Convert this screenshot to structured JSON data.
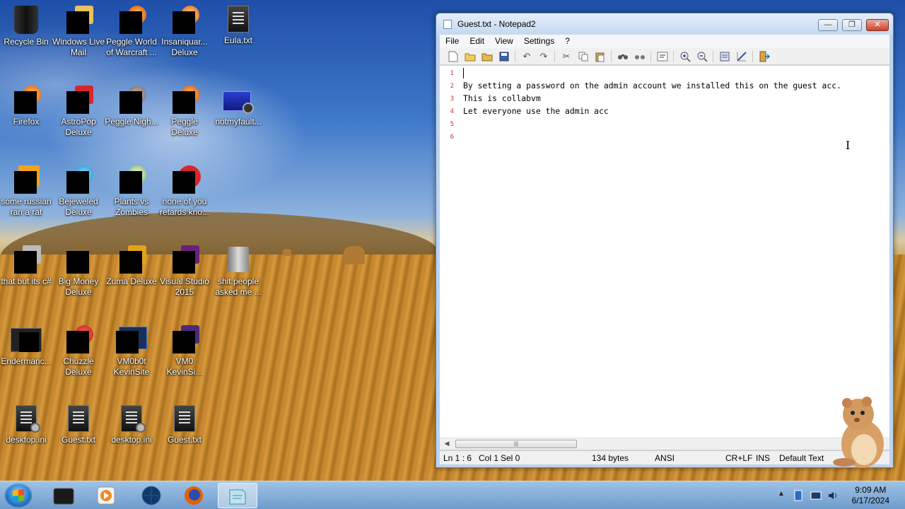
{
  "desktop": {
    "icons": [
      {
        "label": "Recycle Bin"
      },
      {
        "label": "Windows Live Mail"
      },
      {
        "label": "Peggle World of Warcraft ..."
      },
      {
        "label": "Insaniquar... Deluxe"
      },
      {
        "label": "Eula.txt"
      },
      {
        "label": "Firefox"
      },
      {
        "label": "AstroPop Deluxe"
      },
      {
        "label": "Peggle Nigh..."
      },
      {
        "label": "Peggle Deluxe"
      },
      {
        "label": "notmyfault..."
      },
      {
        "label": "some russian ran a rat"
      },
      {
        "label": "Bejeweled Deluxe"
      },
      {
        "label": "Plants vs Zombies"
      },
      {
        "label": "none of you retards kno..."
      },
      {
        "label": "that but its c#"
      },
      {
        "label": "Big Money Deluxe"
      },
      {
        "label": "Zuma Deluxe"
      },
      {
        "label": "Visual Studio 2015"
      },
      {
        "label": "shit people asked me ..."
      },
      {
        "label": "Endermanc..."
      },
      {
        "label": "Chuzzle Deluxe"
      },
      {
        "label": "VM0b0t KevinSite"
      },
      {
        "label": "VM0 KevinSi..."
      },
      {
        "label": "desktop.ini"
      },
      {
        "label": "Guest.txt"
      },
      {
        "label": "desktop.ini"
      },
      {
        "label": "Guest.txt"
      }
    ]
  },
  "window": {
    "title": "Guest.txt - Notepad2",
    "controls": {
      "minimize": "—",
      "maximize": "❐",
      "close": "✕"
    },
    "menu": [
      "File",
      "Edit",
      "View",
      "Settings",
      "?"
    ],
    "lines": [
      {
        "n": "1",
        "text": ""
      },
      {
        "n": "2",
        "text": "By setting a password on the admin account we installed this on the guest acc."
      },
      {
        "n": "3",
        "text": "This is collabvm"
      },
      {
        "n": "4",
        "text": "Let everyone use the admin acc"
      },
      {
        "n": "5",
        "text": ""
      },
      {
        "n": "6",
        "text": ""
      }
    ],
    "status": {
      "position": "Ln 1 : 6",
      "col": "Col 1",
      "sel": "Sel 0",
      "size": "134 bytes",
      "encoding": "ANSI",
      "eol": "CR+LF",
      "mode": "INS",
      "scheme": "Default Text"
    }
  },
  "taskbar": {
    "clock_time": "9:09 AM",
    "clock_date": "6/17/2024"
  }
}
